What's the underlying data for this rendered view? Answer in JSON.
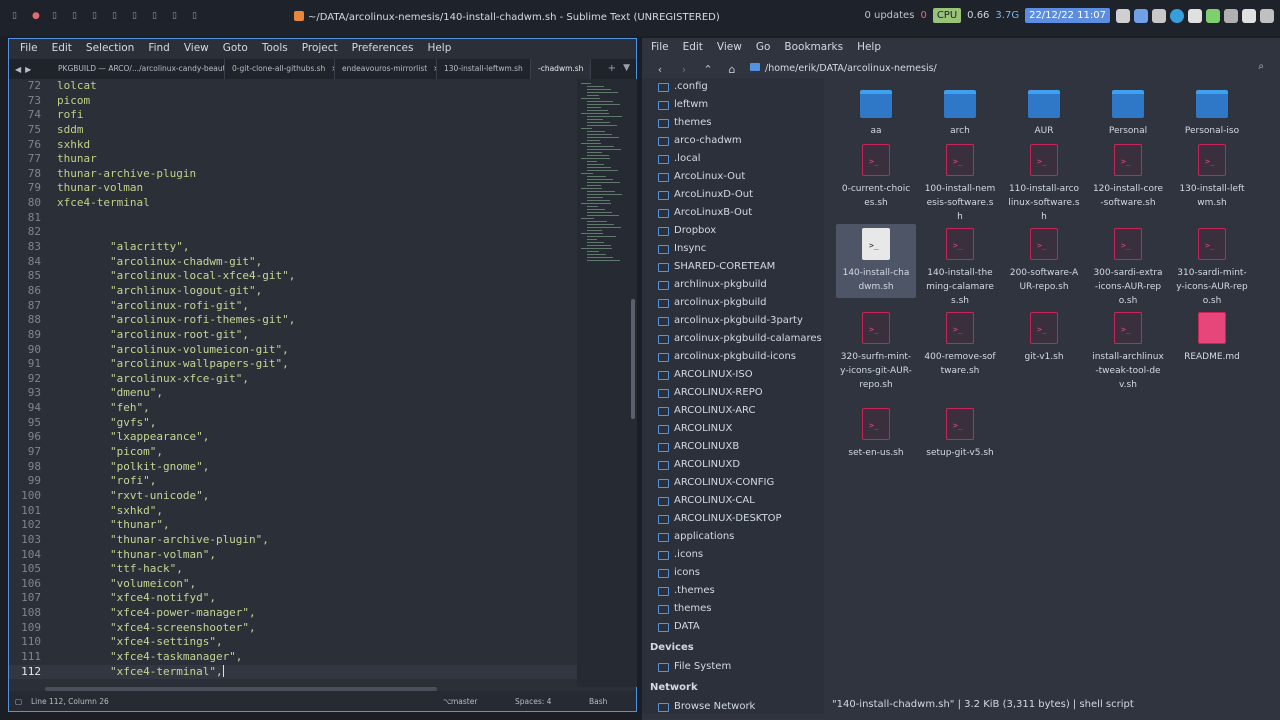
{
  "topbar": {
    "window_title": "~/DATA/arcolinux-nemesis/140-install-chadwm.sh - Sublime Text (UNREGISTERED)",
    "updates": "0 updates",
    "zero": "0",
    "cpu_label": "CPU",
    "cpu_value": "0.66",
    "mem": "3.7G",
    "datetime": "22/12/22 11:07"
  },
  "editor": {
    "menu": [
      "File",
      "Edit",
      "Selection",
      "Find",
      "View",
      "Goto",
      "Tools",
      "Project",
      "Preferences",
      "Help"
    ],
    "tabs": [
      "PKGBUILD — ARCO/.../arcolinux-candy-beauty-dev",
      "0-git-clone-all-githubs.sh",
      "endeavouros-mirrorlist",
      "130-install-leftwm.sh",
      "-chadwm.sh"
    ],
    "lines": [
      {
        "n": "72",
        "t": "lolcat"
      },
      {
        "n": "73",
        "t": "picom"
      },
      {
        "n": "74",
        "t": "rofi"
      },
      {
        "n": "75",
        "t": "sddm"
      },
      {
        "n": "76",
        "t": "sxhkd"
      },
      {
        "n": "77",
        "t": "thunar"
      },
      {
        "n": "78",
        "t": "thunar-archive-plugin"
      },
      {
        "n": "79",
        "t": "thunar-volman"
      },
      {
        "n": "80",
        "t": "xfce4-terminal"
      },
      {
        "n": "81",
        "t": ""
      },
      {
        "n": "82",
        "t": ""
      },
      {
        "n": "83",
        "t": "        \"alacritty\","
      },
      {
        "n": "84",
        "t": "        \"arcolinux-chadwm-git\","
      },
      {
        "n": "85",
        "t": "        \"arcolinux-local-xfce4-git\","
      },
      {
        "n": "86",
        "t": "        \"archlinux-logout-git\","
      },
      {
        "n": "87",
        "t": "        \"arcolinux-rofi-git\","
      },
      {
        "n": "88",
        "t": "        \"arcolinux-rofi-themes-git\","
      },
      {
        "n": "89",
        "t": "        \"arcolinux-root-git\","
      },
      {
        "n": "90",
        "t": "        \"arcolinux-volumeicon-git\","
      },
      {
        "n": "91",
        "t": "        \"arcolinux-wallpapers-git\","
      },
      {
        "n": "92",
        "t": "        \"arcolinux-xfce-git\","
      },
      {
        "n": "93",
        "t": "        \"dmenu\","
      },
      {
        "n": "94",
        "t": "        \"feh\","
      },
      {
        "n": "95",
        "t": "        \"gvfs\","
      },
      {
        "n": "96",
        "t": "        \"lxappearance\","
      },
      {
        "n": "97",
        "t": "        \"picom\","
      },
      {
        "n": "98",
        "t": "        \"polkit-gnome\","
      },
      {
        "n": "99",
        "t": "        \"rofi\","
      },
      {
        "n": "100",
        "t": "        \"rxvt-unicode\","
      },
      {
        "n": "101",
        "t": "        \"sxhkd\","
      },
      {
        "n": "102",
        "t": "        \"thunar\","
      },
      {
        "n": "103",
        "t": "        \"thunar-archive-plugin\","
      },
      {
        "n": "104",
        "t": "        \"thunar-volman\","
      },
      {
        "n": "105",
        "t": "        \"ttf-hack\","
      },
      {
        "n": "106",
        "t": "        \"volumeicon\","
      },
      {
        "n": "107",
        "t": "        \"xfce4-notifyd\","
      },
      {
        "n": "108",
        "t": "        \"xfce4-power-manager\","
      },
      {
        "n": "109",
        "t": "        \"xfce4-screenshooter\","
      },
      {
        "n": "110",
        "t": "        \"xfce4-settings\","
      },
      {
        "n": "111",
        "t": "        \"xfce4-taskmanager\","
      },
      {
        "n": "112",
        "t": "        \"xfce4-terminal\","
      }
    ],
    "status": {
      "position": "Line 112, Column 26",
      "branch": "master",
      "spaces": "Spaces: 4",
      "syntax": "Bash"
    }
  },
  "filemanager": {
    "menu": [
      "File",
      "Edit",
      "View",
      "Go",
      "Bookmarks",
      "Help"
    ],
    "path": "/home/erik/DATA/arcolinux-nemesis/",
    "sidebar": [
      ".config",
      "leftwm",
      "themes",
      "arco-chadwm",
      ".local",
      "ArcoLinux-Out",
      "ArcoLinuxD-Out",
      "ArcoLinuxB-Out",
      "Dropbox",
      "Insync",
      "SHARED-CORETEAM",
      "archlinux-pkgbuild",
      "arcolinux-pkgbuild",
      "arcolinux-pkgbuild-3party",
      "arcolinux-pkgbuild-calamares",
      "arcolinux-pkgbuild-icons",
      "ARCOLINUX-ISO",
      "ARCOLINUX-REPO",
      "ARCOLINUX-ARC",
      "ARCOLINUX",
      "ARCOLINUXB",
      "ARCOLINUXD",
      "ARCOLINUX-CONFIG",
      "ARCOLINUX-CAL",
      "ARCOLINUX-DESKTOP",
      "applications",
      ".icons",
      "icons",
      ".themes",
      "themes",
      "DATA"
    ],
    "devices_header": "Devices",
    "devices": [
      "File System"
    ],
    "network_header": "Network",
    "network": [
      "Browse Network"
    ],
    "files": [
      {
        "name": "aa",
        "kind": "folder"
      },
      {
        "name": "arch",
        "kind": "folder"
      },
      {
        "name": "AUR",
        "kind": "folder"
      },
      {
        "name": "Personal",
        "kind": "folder"
      },
      {
        "name": "Personal-iso",
        "kind": "folder"
      },
      {
        "name": "0-current-choices.sh",
        "kind": "sh"
      },
      {
        "name": "100-install-nemesis-software.sh",
        "kind": "sh"
      },
      {
        "name": "110-install-arcolinux-software.sh",
        "kind": "sh"
      },
      {
        "name": "120-install-core-software.sh",
        "kind": "sh"
      },
      {
        "name": "130-install-leftwm.sh",
        "kind": "sh"
      },
      {
        "name": "140-install-chadwm.sh",
        "kind": "sh-selected"
      },
      {
        "name": "140-install-theming-calamares.sh",
        "kind": "sh"
      },
      {
        "name": "200-software-AUR-repo.sh",
        "kind": "sh"
      },
      {
        "name": "300-sardi-extra-icons-AUR-repo.sh",
        "kind": "sh"
      },
      {
        "name": "310-sardi-mint-y-icons-AUR-repo.sh",
        "kind": "sh"
      },
      {
        "name": "320-surfn-mint-y-icons-git-AUR-repo.sh",
        "kind": "sh"
      },
      {
        "name": "400-remove-software.sh",
        "kind": "sh"
      },
      {
        "name": "git-v1.sh",
        "kind": "sh"
      },
      {
        "name": "install-archlinux-tweak-tool-dev.sh",
        "kind": "sh"
      },
      {
        "name": "README.md",
        "kind": "md"
      },
      {
        "name": "set-en-us.sh",
        "kind": "sh"
      },
      {
        "name": "setup-git-v5.sh",
        "kind": "sh"
      }
    ],
    "status": "\"140-install-chadwm.sh\"  |  3.2 KiB (3,311 bytes)  |  shell script"
  }
}
